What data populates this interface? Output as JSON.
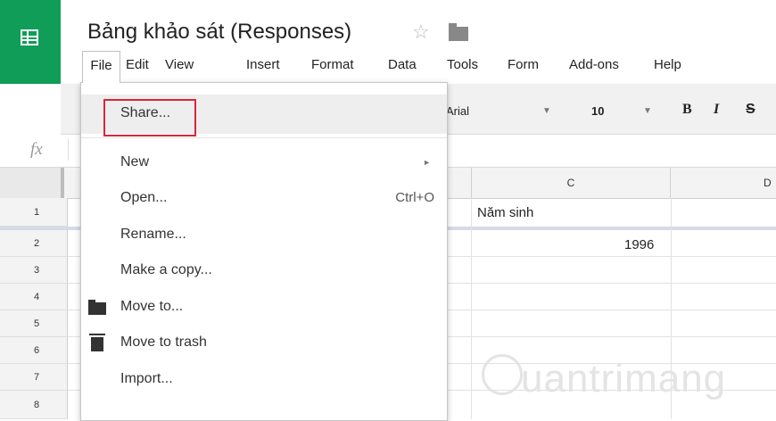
{
  "header": {
    "title": "Bảng khảo sát (Responses)",
    "star": "☆"
  },
  "menubar": [
    "File",
    "Edit",
    "View",
    "Insert",
    "Format",
    "Data",
    "Tools",
    "Form",
    "Add-ons",
    "Help"
  ],
  "toolbar": {
    "font": "Arial",
    "font_size": "10",
    "dropdown_arrow": "▼",
    "bold": "B",
    "italic": "I",
    "strike": "S"
  },
  "formula_bar": {
    "fx": "fx"
  },
  "grid": {
    "columns": [
      "C",
      "D"
    ],
    "rows": [
      "1",
      "2",
      "3",
      "4",
      "5",
      "6",
      "7",
      "8"
    ],
    "cells": {
      "C1": "Năm sinh",
      "C2": "1996"
    }
  },
  "file_menu": {
    "items": [
      {
        "label": "Share...",
        "shortcut": "",
        "submenu": false,
        "icon": ""
      },
      {
        "label": "New",
        "shortcut": "",
        "submenu": true,
        "icon": ""
      },
      {
        "label": "Open...",
        "shortcut": "Ctrl+O",
        "submenu": false,
        "icon": ""
      },
      {
        "label": "Rename...",
        "shortcut": "",
        "submenu": false,
        "icon": ""
      },
      {
        "label": "Make a copy...",
        "shortcut": "",
        "submenu": false,
        "icon": ""
      },
      {
        "label": "Move to...",
        "shortcut": "",
        "submenu": false,
        "icon": "folder-icon"
      },
      {
        "label": "Move to trash",
        "shortcut": "",
        "submenu": false,
        "icon": "trash-icon"
      },
      {
        "label": "Import...",
        "shortcut": "",
        "submenu": false,
        "icon": ""
      }
    ],
    "submenu_arrow": "►",
    "highlight_color": "#d9263b"
  },
  "watermark": "uantrimang",
  "colors": {
    "brand": "#0f9d58",
    "highlight": "#d9263b"
  }
}
